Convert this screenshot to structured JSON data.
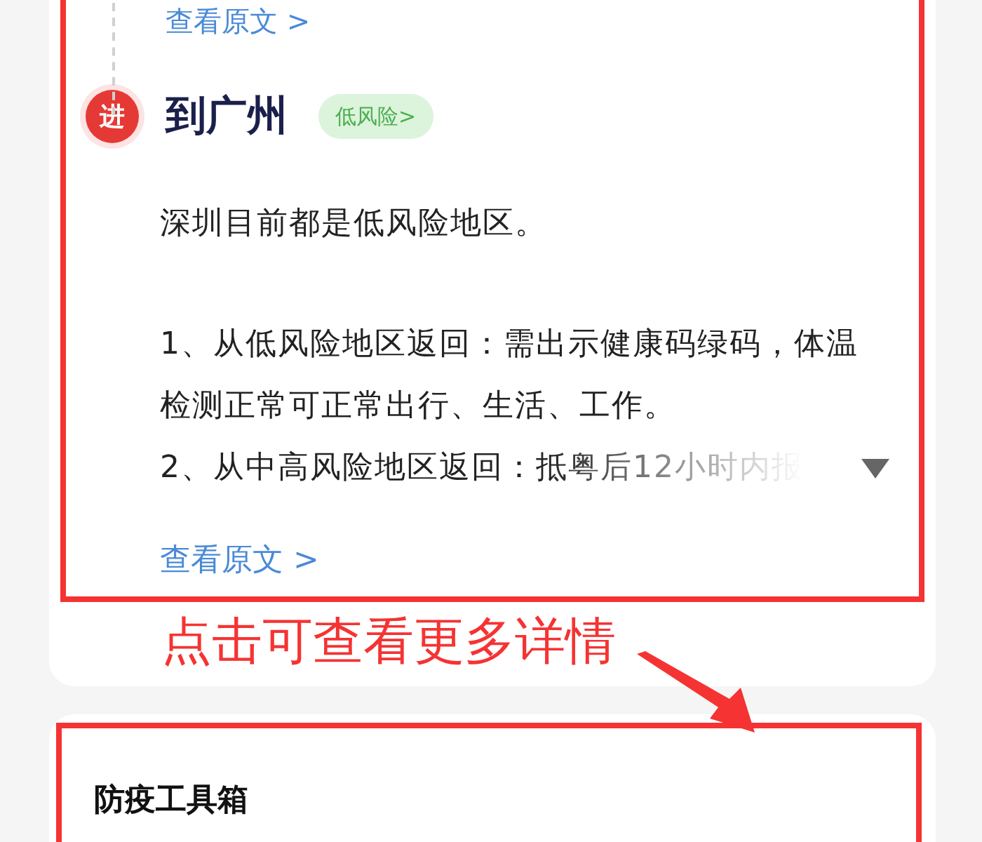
{
  "timeline_top": {
    "link": "查看原文 >"
  },
  "entry": {
    "badge": "进",
    "title": "到广州",
    "risk_tag": "低风险>",
    "paragraphs": [
      "深圳目前都是低风险地区。",
      "1、从低风险地区返回：需出示健康码绿码，体温检测正常可正常出行、生活、工作。",
      "2、从中高风险地区返回：抵粤后12小时内报"
    ],
    "expanded": false,
    "link": "查看原文 >"
  },
  "annotation": "点击可查看更多详情",
  "toolbox": {
    "title": "防疫工具箱"
  }
}
